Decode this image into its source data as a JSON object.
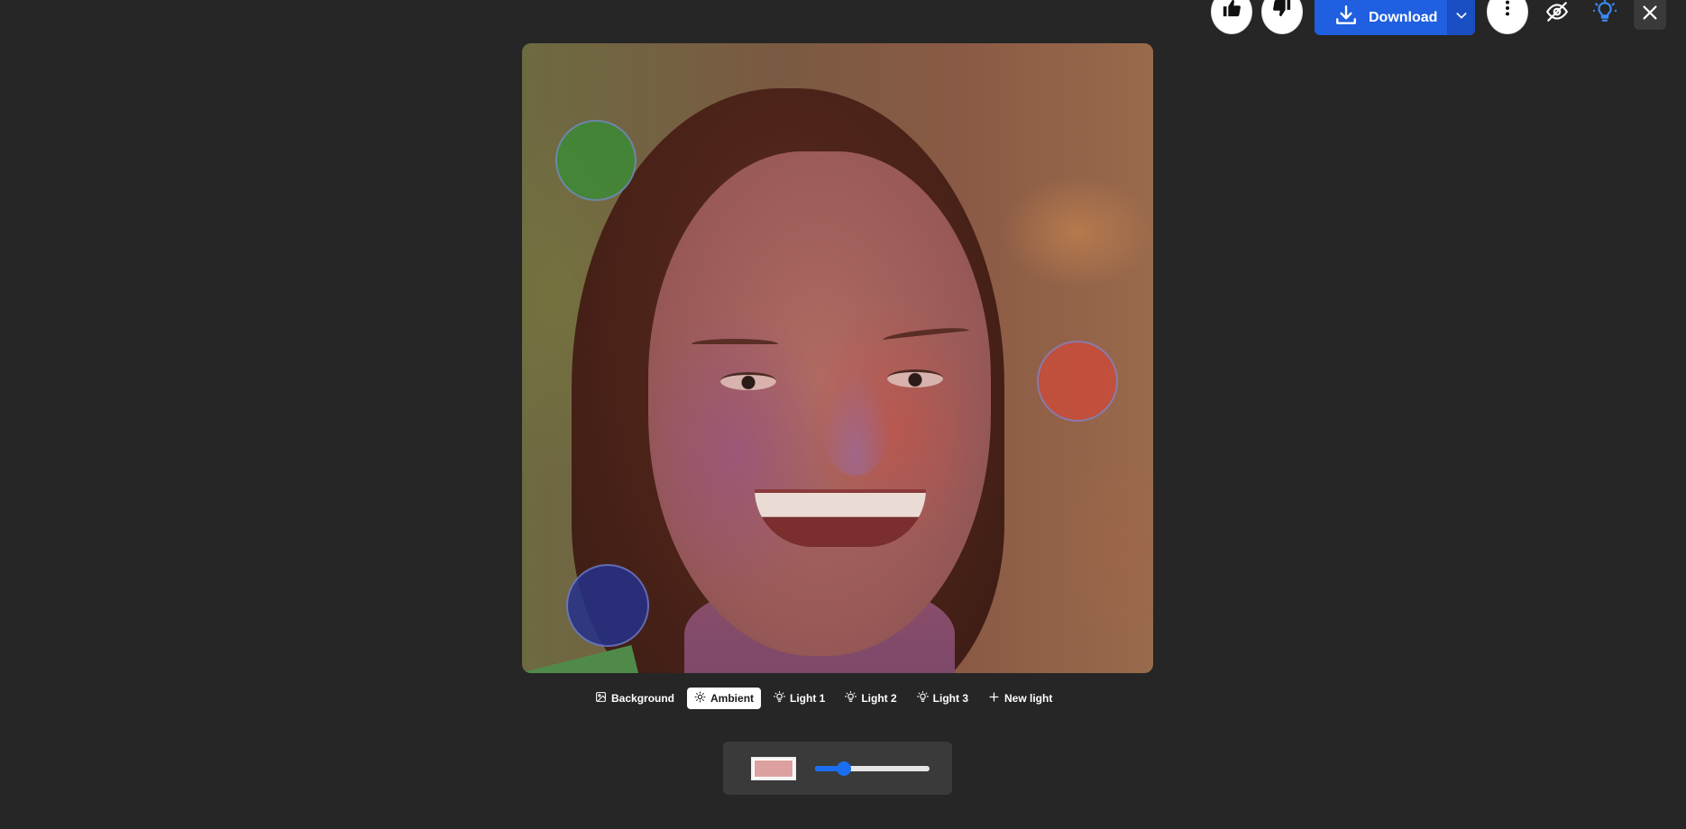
{
  "toolbar": {
    "like_icon": "thumbs-up-icon",
    "dislike_icon": "thumbs-down-icon",
    "download_label": "Download",
    "download_icon": "download-icon",
    "more_icon": "vertical-dots-icon",
    "hide_icon": "eye-off-icon",
    "light_icon": "lightbulb-icon",
    "close_icon": "close-icon",
    "accent_color": "#1f5fe0"
  },
  "tabs": [
    {
      "label": "Background",
      "icon": "image-icon",
      "active": false
    },
    {
      "label": "Ambient",
      "icon": "sun-icon",
      "active": true
    },
    {
      "label": "Light 1",
      "icon": "bulb-icon",
      "active": false
    },
    {
      "label": "Light 2",
      "icon": "bulb-icon",
      "active": false
    },
    {
      "label": "Light 3",
      "icon": "bulb-icon",
      "active": false
    },
    {
      "label": "New light",
      "icon": "plus-icon",
      "active": false
    }
  ],
  "ambient": {
    "color": "#dda0a0",
    "intensity": 0.25
  },
  "lights": [
    {
      "name": "Light 1",
      "color": "#3d8a36"
    },
    {
      "name": "Light 2",
      "color": "#c94c3a"
    },
    {
      "name": "Light 3",
      "color": "#26318a"
    }
  ]
}
